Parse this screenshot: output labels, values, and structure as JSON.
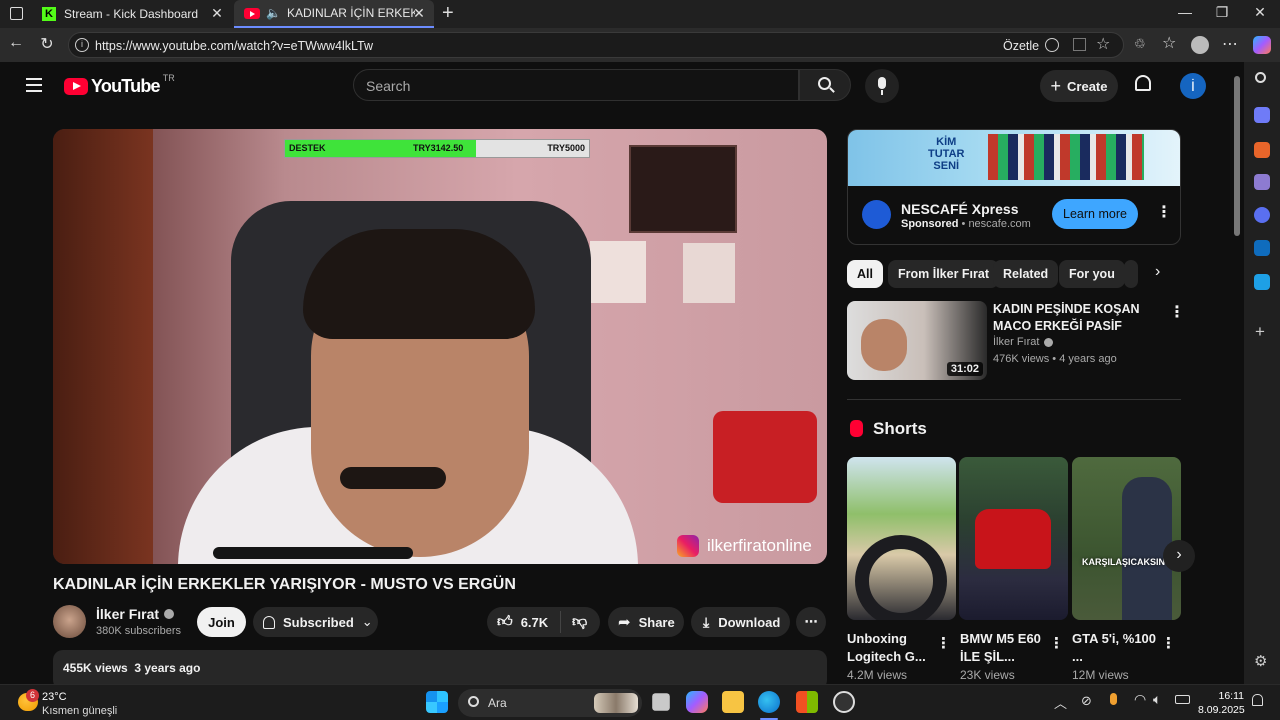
{
  "browser": {
    "tabs": [
      {
        "title": "Stream - Kick Dashboard"
      },
      {
        "title": "KADINLAR İÇİN ERKEKLER YARIŞIYOR"
      }
    ],
    "url": "https://www.youtube.com/watch?v=eTWww4lkLTw",
    "ozetle": "Özetle"
  },
  "yt": {
    "logo_text": "YouTube",
    "region": "TR",
    "search_placeholder": "Search",
    "create_label": "Create",
    "avatar_letter": "İ"
  },
  "video": {
    "destek_label": "DESTEK",
    "destek_current": "TRY3142.50",
    "destek_goal": "TRY5000",
    "destek_fraction": 0.6285,
    "watermark": "ilkerfiratonline",
    "title": "KADINLAR İÇİN ERKEKLER YARIŞIYOR - MUSTO VS ERGÜN",
    "channel": "İlker Fırat",
    "subscribers": "380K subscribers",
    "join_label": "Join",
    "subscribed_label": "Subscribed",
    "likes": "6.7K",
    "share_label": "Share",
    "download_label": "Download",
    "views_date": "455K views  3 years ago"
  },
  "ad": {
    "banner_text_1": "KİM",
    "banner_text_2": "TUTAR",
    "banner_text_3": "SENİ",
    "name": "NESCAFÉ Xpress",
    "sponsored": "Sponsored",
    "domain": "nescafe.com",
    "cta": "Learn more"
  },
  "chips": [
    "All",
    "From İlker Fırat",
    "Related",
    "For you"
  ],
  "recommended": {
    "title": "KADIN PEŞİNDE KOŞAN MACO ERKEĞİ PASİF YAPMA SANATI...",
    "channel": "İlker Fırat",
    "meta": "476K views • 4 years ago",
    "duration": "31:02"
  },
  "shorts": {
    "heading": "Shorts",
    "items": [
      {
        "title": "Unboxing Logitech G...",
        "views": "4.2M views"
      },
      {
        "title": "BMW M5 E60 İLE ŞİL...",
        "views": "23K views"
      },
      {
        "title": "GTA 5'i, %100 ...",
        "views": "12M views",
        "overlay": "KARŞILAŞICAKSIN"
      }
    ]
  },
  "taskbar": {
    "weather_badge": "6",
    "temperature": "23°C",
    "weather_desc": "Kısmen güneşli",
    "search_label": "Ara",
    "time": "16:11",
    "date": "8.09.2025"
  }
}
